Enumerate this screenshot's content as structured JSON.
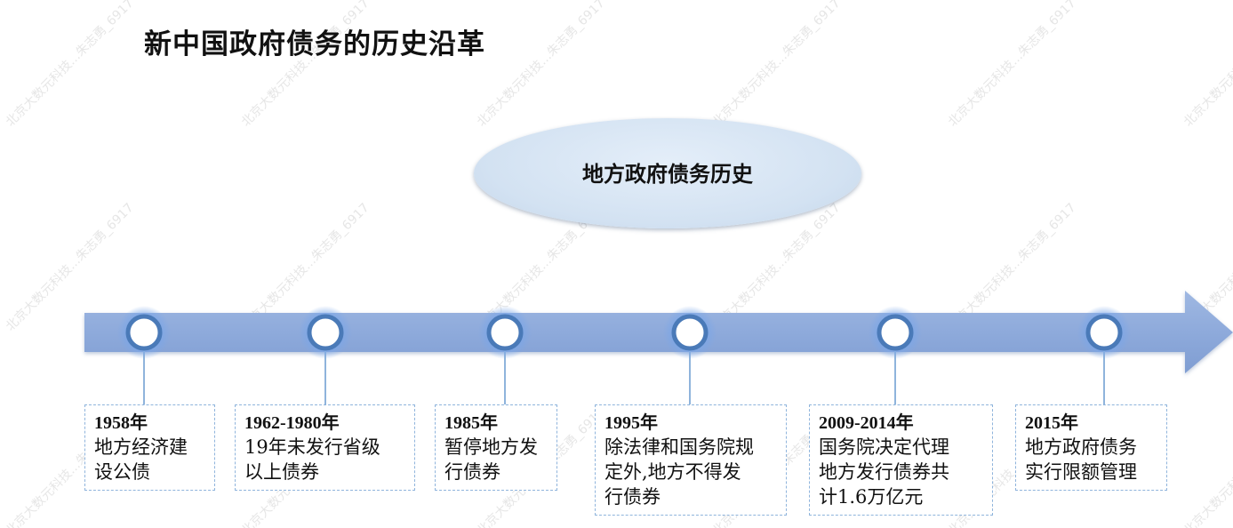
{
  "title": "新中国政府债务的历史沿革",
  "center_label": "地方政府债务历史",
  "events": [
    {
      "year": "1958年",
      "desc": "地方经济建\n设公债"
    },
    {
      "year": "1962-1980年",
      "desc": "19年未发行省级\n以上债券"
    },
    {
      "year": "1985年",
      "desc": "暂停地方发\n行债券"
    },
    {
      "year": "1995年",
      "desc": "除法律和国务院规\n定外,地方不得发\n行债券"
    },
    {
      "year": "2009-2014年",
      "desc": "国务院决定代理\n地方发行债券共\n计1.6万亿元"
    },
    {
      "year": "2015年",
      "desc": "地方政府债务\n实行限额管理"
    }
  ],
  "watermark_text": "北京大数元科技...朱志勇_6917",
  "colors": {
    "arrow": "#8eaadb",
    "node_ring": "#4a7ab8",
    "connector": "#8fb4dc",
    "card_border": "#8fb4dc",
    "ellipse": "#d3e2f2"
  }
}
